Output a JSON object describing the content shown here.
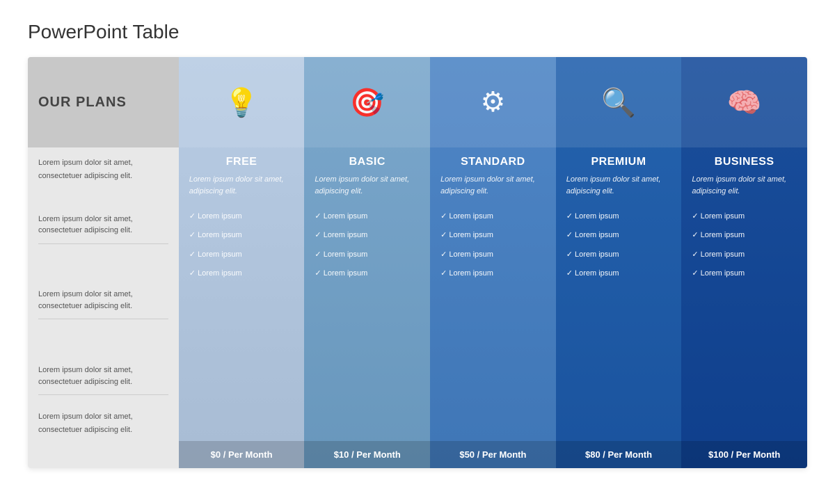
{
  "page": {
    "title": "PowerPoint Table"
  },
  "left_column": {
    "header_label": "OUR PLANS",
    "row_labels": [
      "Lorem ipsum dolor sit amet, consectetuer adipiscing elit.",
      "Lorem ipsum dolor sit amet, consectetuer adipiscing elit.",
      "Lorem ipsum dolor sit amet, consectetuer adipiscing elit.",
      "Lorem ipsum dolor sit amet, consectetuer adipiscing elit.",
      "Lorem ipsum dolor sit amet, consectetuer adipiscing elit."
    ]
  },
  "plans": [
    {
      "id": "free",
      "name": "FREE",
      "icon": "💡",
      "description": "Lorem ipsum dolor sit amet, adipiscing elit.",
      "features": [
        "Lorem ipsum",
        "Lorem ipsum",
        "Lorem ipsum",
        "Lorem ipsum"
      ],
      "price": "$0 / Per Month",
      "col_class": "col-free"
    },
    {
      "id": "basic",
      "name": "BASIC",
      "icon": "🎯",
      "description": "Lorem ipsum dolor sit amet, adipiscing elit.",
      "features": [
        "Lorem ipsum",
        "Lorem ipsum",
        "Lorem ipsum",
        "Lorem ipsum"
      ],
      "price": "$10 / Per Month",
      "col_class": "col-basic"
    },
    {
      "id": "standard",
      "name": "STANDARD",
      "icon": "⚙",
      "description": "Lorem ipsum dolor sit amet, adipiscing elit.",
      "features": [
        "Lorem ipsum",
        "Lorem ipsum",
        "Lorem ipsum",
        "Lorem ipsum"
      ],
      "price": "$50 / Per Month",
      "col_class": "col-standard"
    },
    {
      "id": "premium",
      "name": "PREMIUM",
      "icon": "🔍",
      "description": "Lorem ipsum dolor sit amet, adipiscing elit.",
      "features": [
        "Lorem ipsum",
        "Lorem ipsum",
        "Lorem ipsum",
        "Lorem ipsum"
      ],
      "price": "$80 / Per Month",
      "col_class": "col-premium"
    },
    {
      "id": "business",
      "name": "BUSINESS",
      "icon": "🧠",
      "description": "Lorem ipsum dolor sit amet, adipiscing elit.",
      "features": [
        "Lorem ipsum",
        "Lorem ipsum",
        "Lorem ipsum",
        "Lorem ipsum"
      ],
      "price": "$100 / Per Month",
      "col_class": "col-business"
    }
  ]
}
